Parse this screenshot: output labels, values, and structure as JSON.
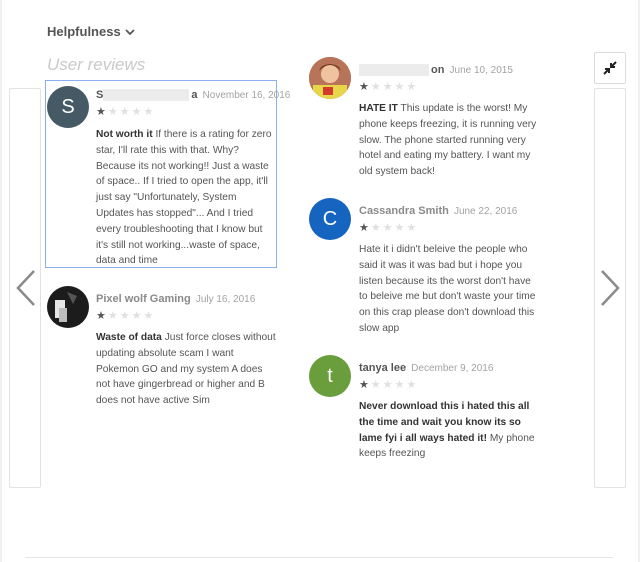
{
  "toolbar": {
    "sort_label": "Helpfulness"
  },
  "section": {
    "heading": "User reviews"
  },
  "reviews": [
    {
      "initial": "S",
      "avatar_color": "#455a64",
      "author_visible": "S",
      "author_tail": "a",
      "date": "November 16, 2016",
      "rating": 1,
      "title": "Not worth it",
      "body": "If there is a rating for zero star, I'll rate this with that. Why? Because its not working!! Just a waste of space.. If I tried to open the app, it'll just say \"Unfortunately, System Updates has stopped\"... And I tried every troubleshooting that I know but it's still not working...waste of space, data and time"
    },
    {
      "initial": "",
      "avatar_color": "#1c1c1c",
      "author_visible": "Pixel wolf Gaming",
      "author_tail": "",
      "date": "July 16, 2016",
      "rating": 1,
      "title": "Waste of data",
      "body": "Just force closes without updating absolute scam I want Pokemon GO and my system A does not have gingerbread or higher and B does not have active Sim"
    },
    {
      "initial": "",
      "avatar_color": "#9c5b45",
      "author_visible": "",
      "author_tail": "on",
      "date": "June 10, 2015",
      "rating": 1,
      "title": "HATE IT",
      "body": "This update is the worst! My phone keeps freezing, it is running very slow. The phone started running very hotel and eating my battery. I want my old system back!"
    },
    {
      "initial": "C",
      "avatar_color": "#1565c0",
      "author_visible": "Cassandra Smith",
      "author_tail": "",
      "date": "June 22, 2016",
      "rating": 1,
      "title": "",
      "body": "Hate it i didn't beleive the people who said it was it was bad but i hope you listen because its the worst don't have to beleive me but don't waste your time on this crap please don't download this slow app"
    },
    {
      "initial": "t",
      "avatar_color": "#6a9e3c",
      "author_visible": "tanya lee",
      "author_tail": "",
      "date": "December 9, 2016",
      "rating": 1,
      "title": "Never download this i hated this all the time and wait you know its so lame fyi i all ways hated it!",
      "body": "My phone keeps freezing"
    }
  ]
}
